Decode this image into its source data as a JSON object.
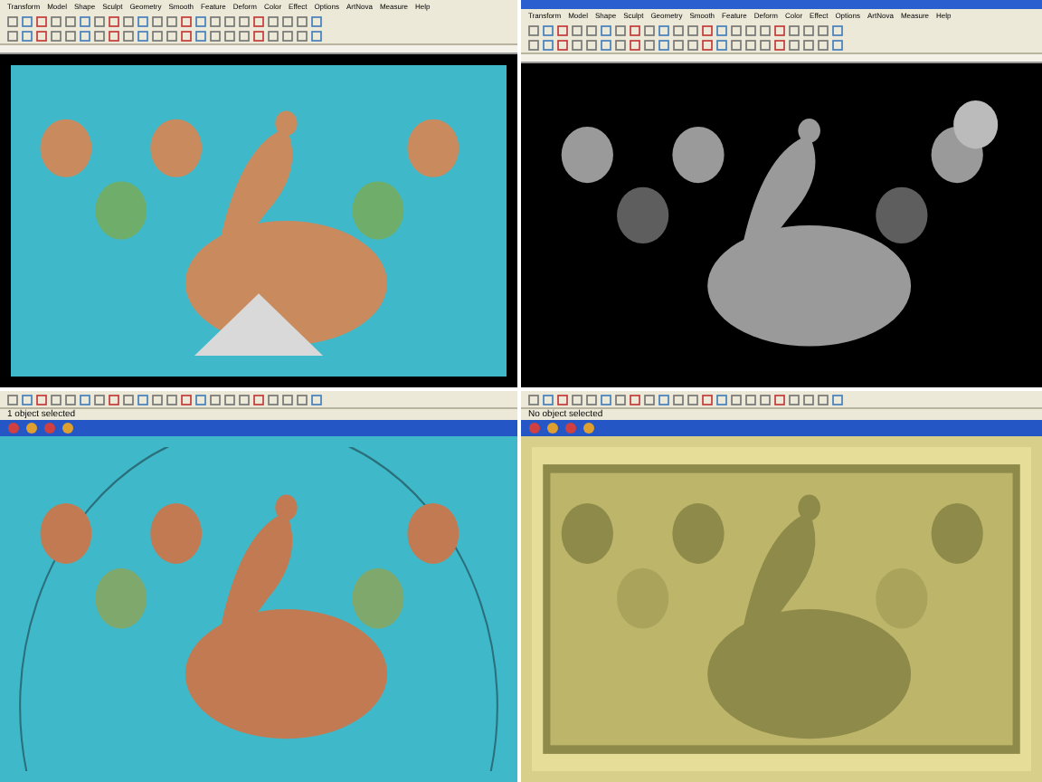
{
  "panels": [
    {
      "menu": [
        "Transform",
        "Model",
        "Shape",
        "Sculpt",
        "Geometry",
        "Smooth",
        "Feature",
        "Deform",
        "Color",
        "Effect",
        "Options",
        "ArtNova",
        "Measure",
        "Help"
      ]
    },
    {
      "menu": [
        "Transform",
        "Model",
        "Shape",
        "Sculpt",
        "Geometry",
        "Smooth",
        "Feature",
        "Deform",
        "Color",
        "Effect",
        "Options",
        "ArtNova",
        "Measure",
        "Help"
      ]
    },
    {
      "status": "1 object selected"
    },
    {
      "status": "No object selected"
    }
  ]
}
